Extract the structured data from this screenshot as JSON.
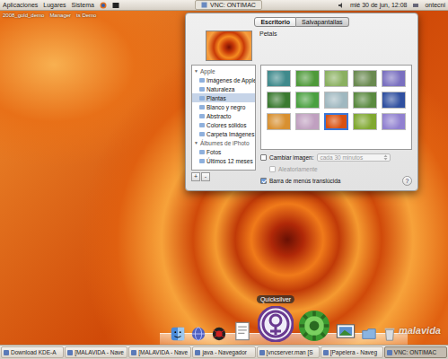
{
  "top_panel": {
    "menus": [
      "Aplicaciones",
      "Lugares",
      "Sistema"
    ],
    "window_title": "VNC: ONTIMAC",
    "clock": "mié 30 de jun, 12:08",
    "user": "ontecni"
  },
  "desktop_icons": [
    {
      "label": "2008_gold_demo"
    },
    {
      "label": "Manager"
    },
    {
      "label": "ts Demo"
    }
  ],
  "window": {
    "tabs": [
      {
        "label": "Escritorio",
        "selected": true
      },
      {
        "label": "Salvapantallas",
        "selected": false
      }
    ],
    "preview": {
      "label": "Petals"
    },
    "sidebar": {
      "items": [
        {
          "label": "Apple",
          "kind": "group",
          "toggle": "▼",
          "selected": false
        },
        {
          "label": "Imágenes de Apple",
          "kind": "item",
          "selected": false
        },
        {
          "label": "Naturaleza",
          "kind": "item",
          "selected": false
        },
        {
          "label": "Plantas",
          "kind": "item",
          "selected": true
        },
        {
          "label": "Blanco y negro",
          "kind": "item",
          "selected": false
        },
        {
          "label": "Abstracto",
          "kind": "item",
          "selected": false
        },
        {
          "label": "Colores sólidos",
          "kind": "item",
          "selected": false
        },
        {
          "label": "Carpeta Imágenes",
          "kind": "item",
          "selected": false
        },
        {
          "label": "Álbumes de iPhoto",
          "kind": "group",
          "toggle": "▼",
          "selected": false
        },
        {
          "label": "Fotos",
          "kind": "item",
          "selected": false
        },
        {
          "label": "Últimos 12 meses",
          "kind": "item",
          "selected": false
        }
      ]
    },
    "sidebar_buttons": [
      "+",
      "-"
    ],
    "thumbnails": [
      {
        "color": "#3f8a8c",
        "selected": false
      },
      {
        "color": "#4f9a3a",
        "selected": false
      },
      {
        "color": "#8ab060",
        "selected": false
      },
      {
        "color": "#6a8a50",
        "selected": false
      },
      {
        "color": "#7a70c0",
        "selected": false
      },
      {
        "color": "#3a7a30",
        "selected": false
      },
      {
        "color": "#4aa040",
        "selected": false
      },
      {
        "color": "#a0b8c0",
        "selected": false
      },
      {
        "color": "#5a8a40",
        "selected": false
      },
      {
        "color": "#3050a0",
        "selected": false
      },
      {
        "color": "#d89030",
        "selected": false
      },
      {
        "color": "#c0a0c0",
        "selected": false
      },
      {
        "color": "#d85010",
        "selected": true
      },
      {
        "color": "#80a830",
        "selected": false
      },
      {
        "color": "#9080d0",
        "selected": false
      }
    ],
    "options": [
      {
        "label": "Cambiar imagen:",
        "kind": "checkbox-select",
        "checked": false,
        "disabled": false,
        "select": {
          "value": "cada 30 minutos",
          "disabled": true
        }
      },
      {
        "label": "Aleatoriamente",
        "kind": "checkbox",
        "checked": false,
        "disabled": true
      },
      {
        "label": "Barra de menús translúcida",
        "kind": "checkbox",
        "checked": true,
        "disabled": false
      }
    ],
    "help": "?"
  },
  "dock": {
    "tooltip": "Quicksilver",
    "items": [
      {
        "kind": "finder"
      },
      {
        "kind": "globe"
      },
      {
        "kind": "spider"
      },
      {
        "kind": "document"
      },
      {
        "kind": "quicksilver"
      },
      {
        "kind": "gear"
      },
      {
        "kind": "photo"
      },
      {
        "kind": "folder"
      },
      {
        "kind": "trash"
      }
    ]
  },
  "watermark": "malavida",
  "taskbar": {
    "items": [
      {
        "label": "Download KDE-A",
        "selected": false
      },
      {
        "label": "[MALAVIDA - Nave",
        "selected": false
      },
      {
        "label": "[MALAVIDA - Nave",
        "selected": false
      },
      {
        "label": "java - Navegador",
        "selected": false
      },
      {
        "label": "[vncserver.man [S",
        "selected": false
      },
      {
        "label": "[Papelera - Naveg",
        "selected": false
      },
      {
        "label": "VNC: ONTIMAC",
        "selected": true
      }
    ]
  }
}
